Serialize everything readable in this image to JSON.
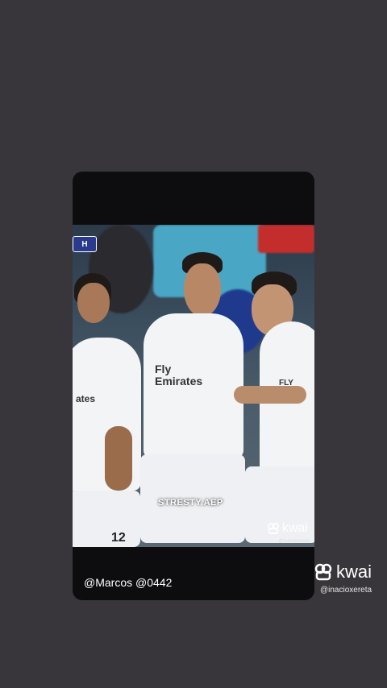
{
  "video": {
    "overlay_text": "STRESTY.AEP",
    "channel_badge": "H",
    "shirt_sponsor_center": "Fly\nEmirates",
    "shirt_sponsor_right": "FLY EMIR",
    "shirt_sponsor_left": "ates",
    "player_number": "12",
    "watermark_brand": "kwai",
    "watermark_handle": "@inacioxereta"
  },
  "caption": "@Marcos @0442",
  "watermark": {
    "brand": "kwai",
    "handle": "@inacioxereta"
  },
  "colors": {
    "background": "#38363a",
    "card": "#0d0d0f",
    "kit": "#f2f4f6"
  }
}
